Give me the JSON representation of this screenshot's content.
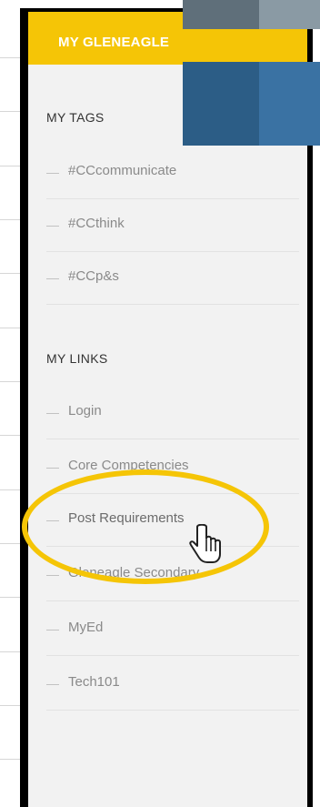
{
  "header": {
    "title": "MY GLENEAGLE"
  },
  "tags": {
    "heading": "MY TAGS",
    "items": [
      {
        "label": "#CCcommunicate"
      },
      {
        "label": "#CCthink"
      },
      {
        "label": "#CCp&s"
      }
    ]
  },
  "links": {
    "heading": "MY LINKS",
    "items": [
      {
        "label": "Login"
      },
      {
        "label": "Core Competencies"
      },
      {
        "label": "Post Requirements"
      },
      {
        "label": "Gleneagle Secondary"
      },
      {
        "label": "MyEd"
      },
      {
        "label": "Tech101"
      }
    ]
  },
  "colors": {
    "header": "#f5c506",
    "highlight": "#f5c506",
    "panel": "#f2f2f2"
  }
}
